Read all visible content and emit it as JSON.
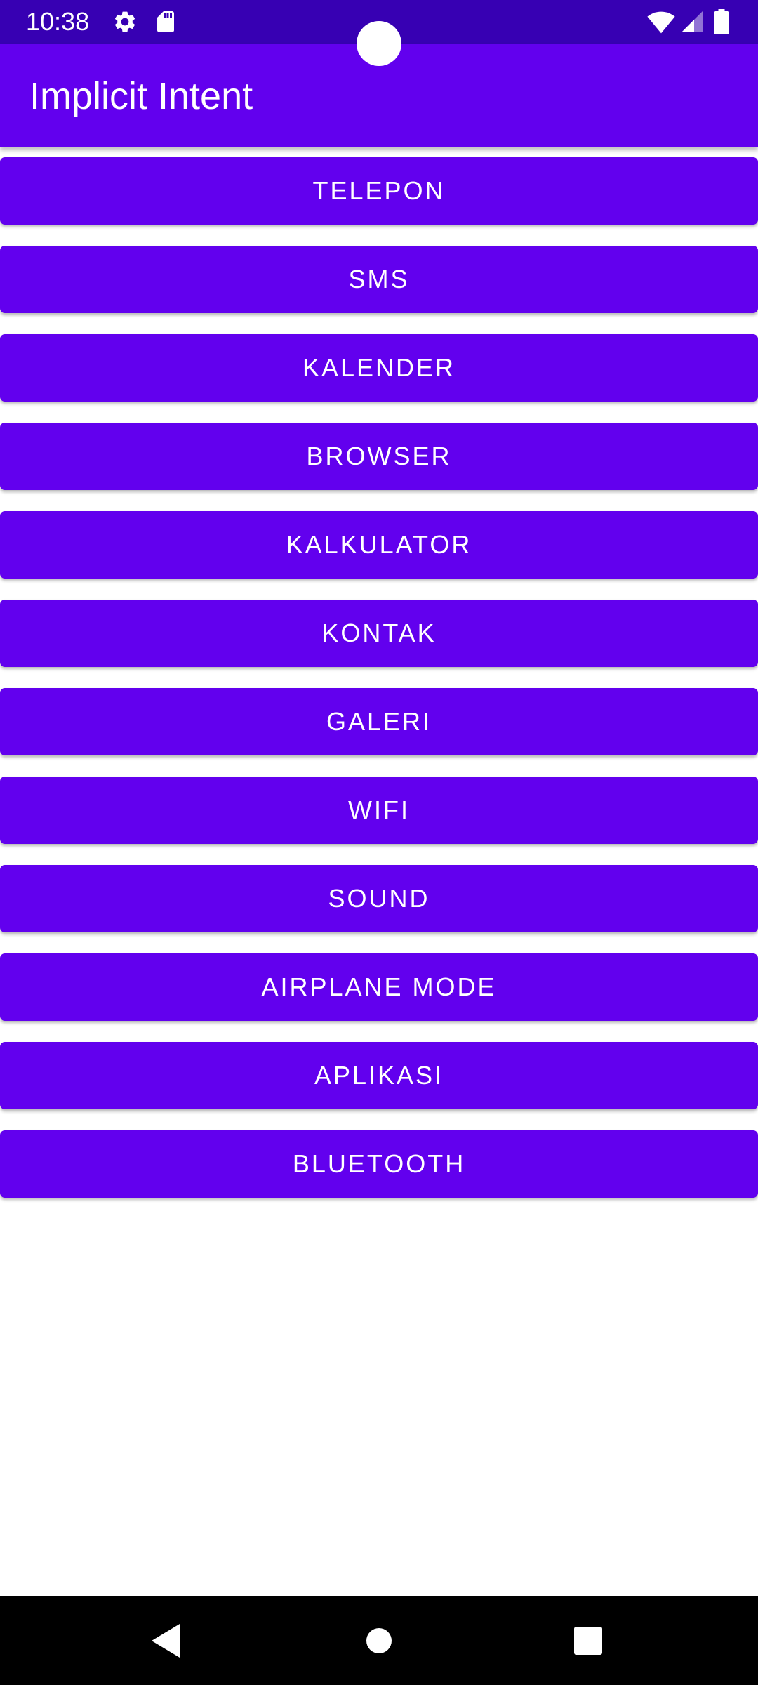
{
  "status_bar": {
    "time": "10:38",
    "icons": [
      "gear-icon",
      "sd-card-icon",
      "wifi-icon",
      "cellular-signal-icon",
      "battery-icon"
    ],
    "background": "#3700b3"
  },
  "app_bar": {
    "title": "Implicit Intent",
    "background": "#6200ee"
  },
  "buttons": [
    {
      "label": "TELEPON"
    },
    {
      "label": "SMS"
    },
    {
      "label": "KALENDER"
    },
    {
      "label": "BROWSER"
    },
    {
      "label": "KALKULATOR"
    },
    {
      "label": "KONTAK"
    },
    {
      "label": "GALERI"
    },
    {
      "label": "WIFI"
    },
    {
      "label": "SOUND"
    },
    {
      "label": "AIRPLANE MODE"
    },
    {
      "label": "APLIKASI"
    },
    {
      "label": "BLUETOOTH"
    }
  ],
  "button_color": "#6200ee",
  "nav_bar": {
    "icons": [
      "back-icon",
      "home-icon",
      "recents-icon"
    ],
    "background": "#000000"
  }
}
